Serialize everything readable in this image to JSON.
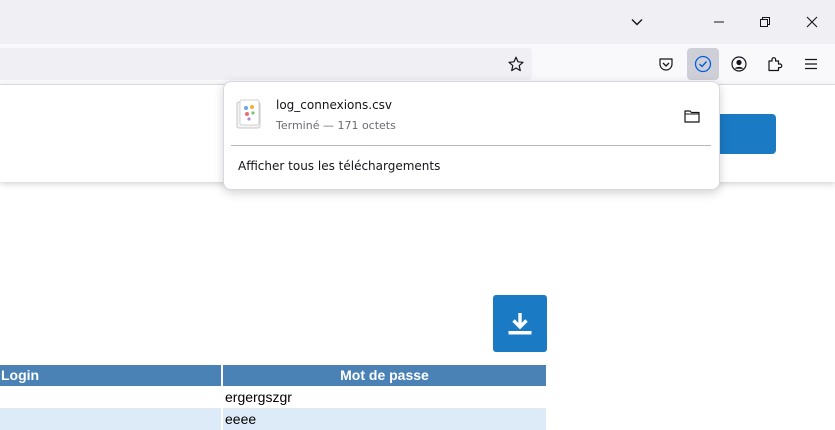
{
  "browser": {
    "tabs_menu_icon": "chevron-down-icon",
    "window_controls": [
      "minimize-icon",
      "restore-icon",
      "close-icon"
    ],
    "toolbar_icons": [
      "bookmark-star-icon",
      "pocket-icon",
      "downloads-icon",
      "account-icon",
      "extensions-icon",
      "menu-icon"
    ]
  },
  "downloads_panel": {
    "items": [
      {
        "file_name": "log_connexions.csv",
        "status": "Terminé — 171 octets"
      }
    ],
    "show_all_label": "Afficher tous les téléchargements"
  },
  "table": {
    "headers": [
      "Login",
      "Mot de passe"
    ],
    "rows": [
      [
        "",
        "ergergszgr"
      ],
      [
        "",
        "eeee"
      ]
    ]
  },
  "colors": {
    "accent": "#1a7ac4",
    "table_header": "#4a82b6",
    "table_row_alt": "#dcebf7"
  }
}
